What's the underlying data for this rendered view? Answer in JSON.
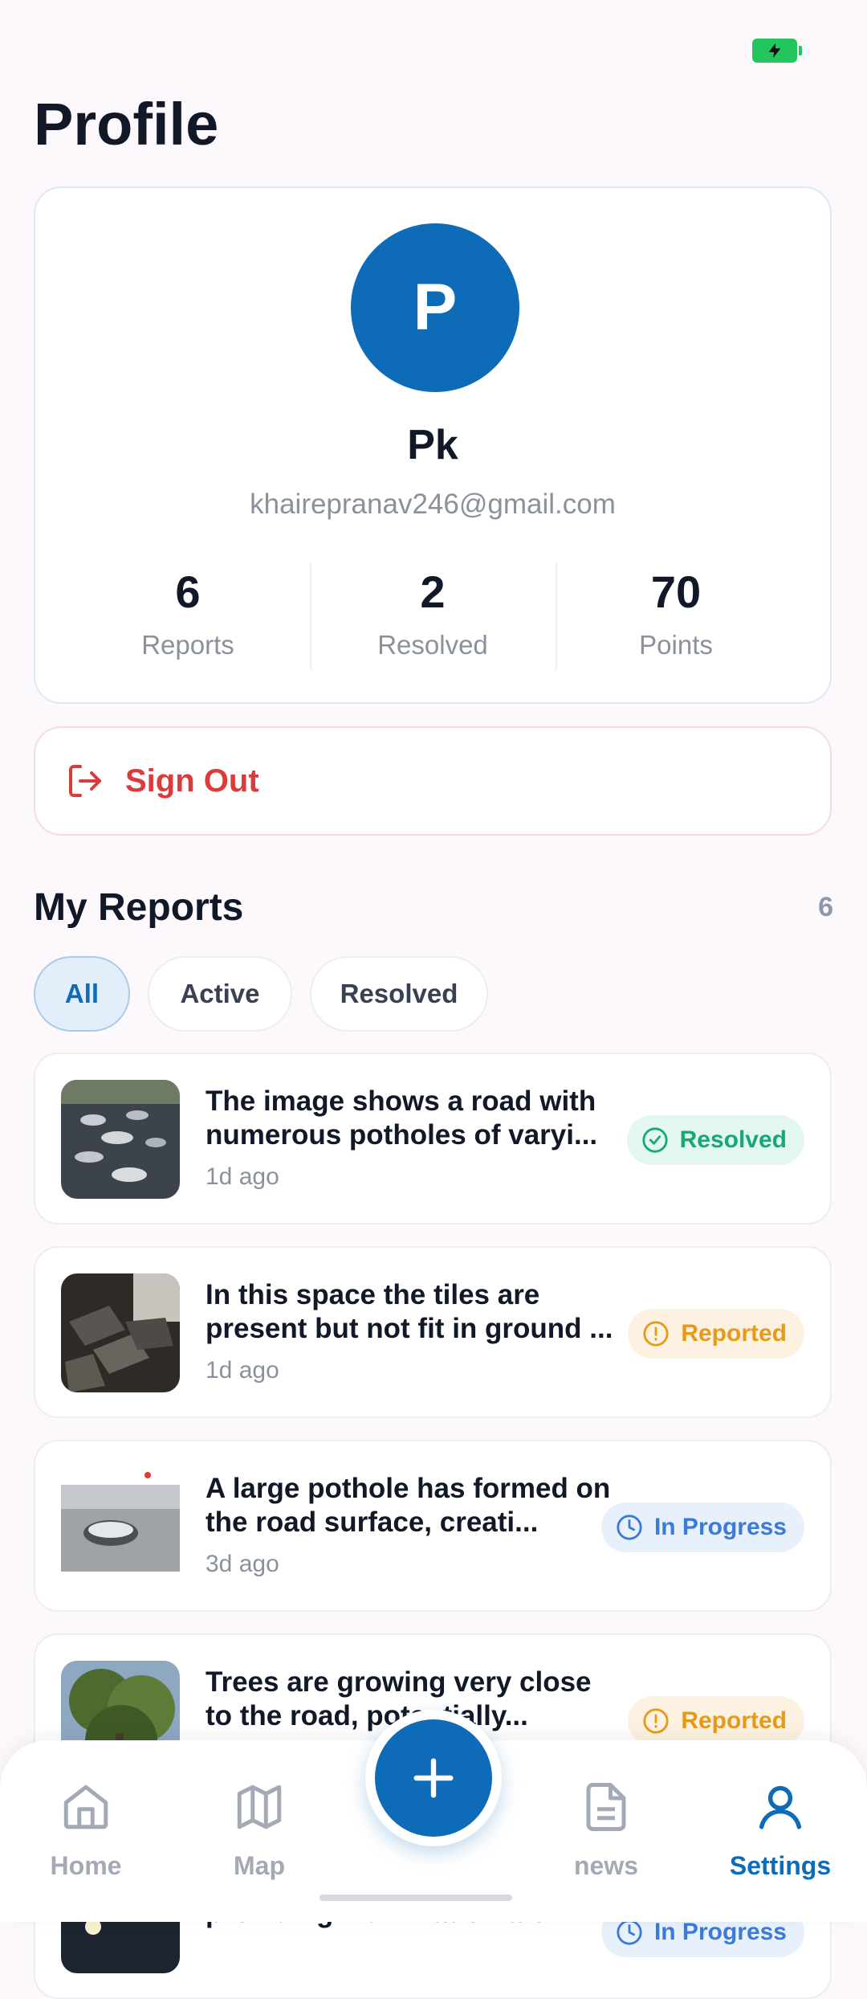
{
  "status_bar": {
    "battery_icon": "battery-charging-icon"
  },
  "page": {
    "title": "Profile"
  },
  "profile": {
    "avatar_letter": "P",
    "name": "Pk",
    "email": "khairepranav246@gmail.com",
    "stats": [
      {
        "value": "6",
        "label": "Reports"
      },
      {
        "value": "2",
        "label": "Resolved"
      },
      {
        "value": "70",
        "label": "Points"
      }
    ]
  },
  "sign_out": {
    "label": "Sign Out",
    "icon": "log-out-icon"
  },
  "reports_section": {
    "title": "My Reports",
    "count": "6",
    "filters": [
      "All",
      "Active",
      "Resolved"
    ],
    "active_filter": "All"
  },
  "reports": [
    {
      "title": "The image shows a road with numerous potholes of varyi...",
      "time": "1d ago",
      "status": "Resolved",
      "status_icon": "check-circle-icon"
    },
    {
      "title": "In this space the tiles are present but not fit in ground ...",
      "time": "1d ago",
      "status": "Reported",
      "status_icon": "alert-circle-icon"
    },
    {
      "title": "A large pothole has formed on the road surface, creati...",
      "time": "3d ago",
      "status": "In Progress",
      "status_icon": "clock-icon"
    },
    {
      "title": "Trees are growing very close to the road, potentially...",
      "time": "",
      "status": "Reported",
      "status_icon": "alert-circle-icon"
    },
    {
      "title": "providing illumination alon...",
      "time": "",
      "status": "In Progress",
      "status_icon": "clock-icon"
    }
  ],
  "bottom_nav": {
    "items": [
      {
        "label": "Home",
        "icon": "home-icon"
      },
      {
        "label": "Map",
        "icon": "map-icon"
      },
      {
        "label": "news",
        "icon": "document-icon"
      },
      {
        "label": "Settings",
        "icon": "user-icon"
      }
    ],
    "active": "Settings",
    "fab_icon": "plus-icon"
  },
  "colors": {
    "primary": "#0d6bb8",
    "danger": "#dc3b3b",
    "resolved": "#16a974",
    "reported": "#e79a17",
    "in_progress": "#3b7ad8",
    "background": "#fdf8fc"
  }
}
